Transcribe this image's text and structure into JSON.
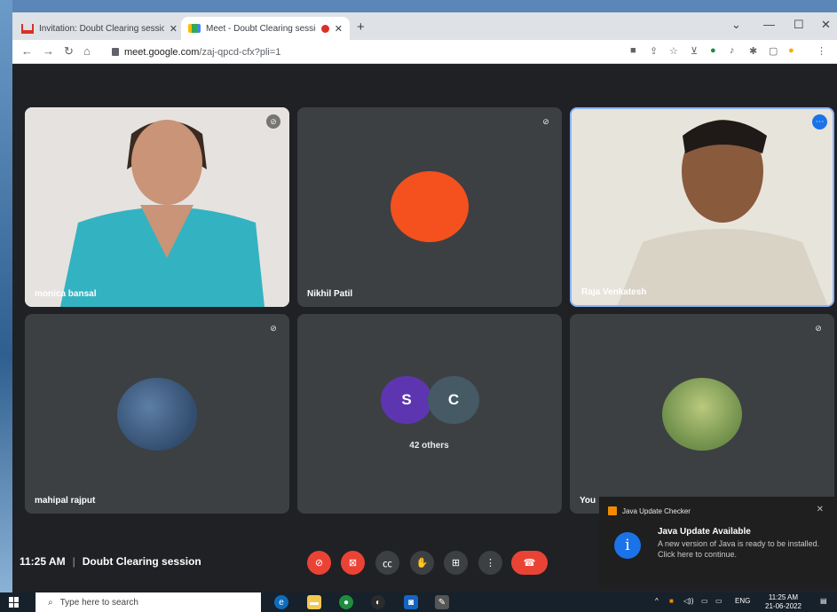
{
  "browser": {
    "tabs": [
      {
        "title": "Invitation: Doubt Clearing session",
        "icon": "gmail-icon"
      },
      {
        "title": "Meet - Doubt Clearing session",
        "icon": "google-meet-icon",
        "recording": true
      }
    ],
    "new_tab": "+",
    "url_host": "meet.google.com",
    "url_path": "/zaj-qpcd-cfx?pli=1"
  },
  "meet": {
    "participants": [
      {
        "name": "monica bansal",
        "muted": true,
        "video": true
      },
      {
        "name": "Nikhil Patil",
        "muted": true,
        "video": false,
        "avatar_color": "#f4511e"
      },
      {
        "name": "Raja Venkatesh",
        "muted": false,
        "video": true,
        "speaking": true
      },
      {
        "name": "mahipal rajput",
        "muted": true,
        "video": false
      },
      {
        "name": "",
        "others_label": "42 others",
        "avatars": [
          {
            "letter": "S",
            "color": "#5e35b1"
          },
          {
            "letter": "C",
            "color": "#455a64"
          }
        ]
      },
      {
        "name": "You",
        "muted": true,
        "video": false
      }
    ],
    "time": "11:25 AM",
    "separator": "|",
    "meeting_title": "Doubt Clearing session",
    "controls": [
      "microphone-off",
      "camera-off",
      "captions",
      "raise-hand",
      "present",
      "more-options",
      "leave-call"
    ]
  },
  "toast": {
    "app": "Java Update Checker",
    "title": "Java Update Available",
    "line1": "A new version of Java is ready to be installed.",
    "line2": "Click here to continue.",
    "close": "✕"
  },
  "taskbar": {
    "search_placeholder": "Type here to search",
    "lang": "ENG",
    "time": "11:25 AM",
    "date": "21-06-2022"
  }
}
